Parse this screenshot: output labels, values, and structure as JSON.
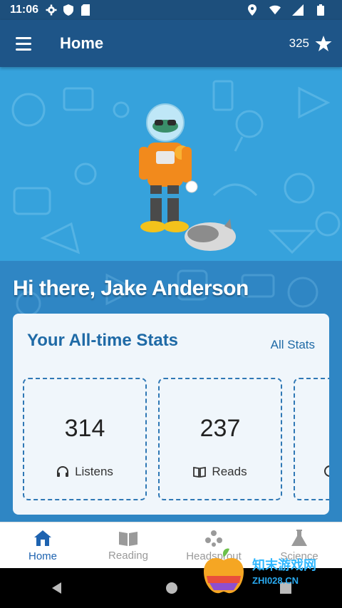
{
  "status_bar": {
    "time": "11:06"
  },
  "app_bar": {
    "title": "Home",
    "points": "325"
  },
  "greeting": "Hi there, Jake Anderson",
  "stats": {
    "title": "Your All-time Stats",
    "all_stats_label": "All Stats",
    "tiles": [
      {
        "value": "314",
        "label": "Listens",
        "icon": "headphones-icon"
      },
      {
        "value": "237",
        "label": "Reads",
        "icon": "book-icon"
      }
    ]
  },
  "bottom_nav": {
    "items": [
      {
        "label": "Home",
        "icon": "house-icon",
        "active": true
      },
      {
        "label": "Reading",
        "icon": "book-icon",
        "active": false
      },
      {
        "label": "Headsprout",
        "icon": "headsprout-icon",
        "active": false
      },
      {
        "label": "Science",
        "icon": "flask-icon",
        "active": false
      }
    ]
  },
  "watermark": {
    "text": "知末游戏网",
    "url": "ZHI028.CN"
  },
  "colors": {
    "app_bar": "#1e5588",
    "status_bar": "#1d4f7c",
    "accent": "#1e63b0",
    "hero": "#36a2dc"
  }
}
